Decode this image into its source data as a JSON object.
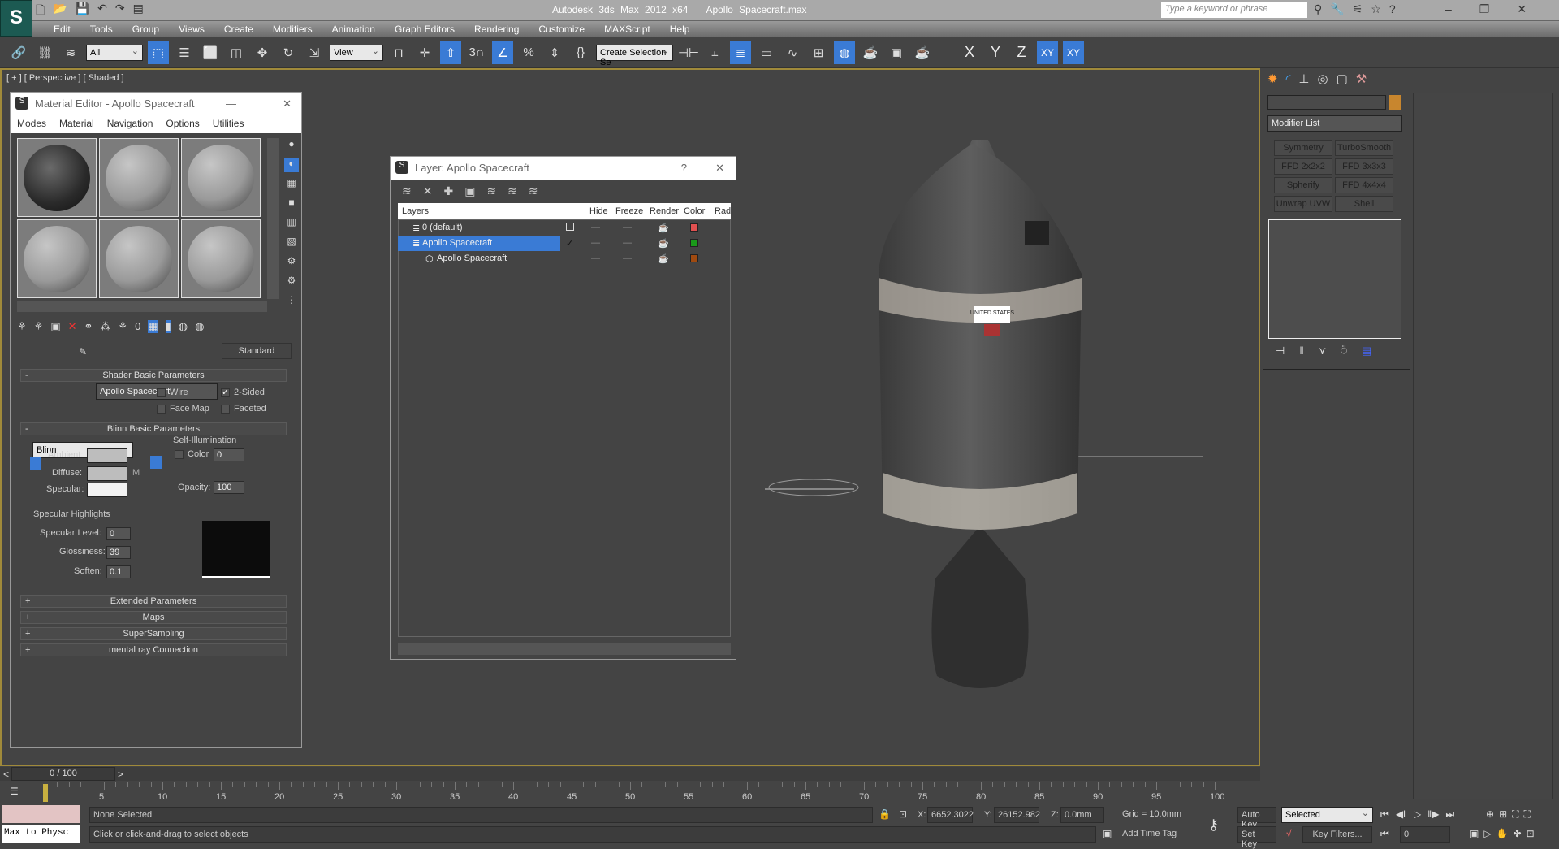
{
  "app": {
    "title": "Autodesk 3ds Max  2012 x64",
    "file": "Apollo Spacecraft.max",
    "search_placeholder": "Type a keyword or phrase"
  },
  "menu": [
    "Edit",
    "Tools",
    "Group",
    "Views",
    "Create",
    "Modifiers",
    "Animation",
    "Graph Editors",
    "Rendering",
    "Customize",
    "MAXScript",
    "Help"
  ],
  "toolbar": {
    "filter": "All",
    "ref_coord": "View",
    "selection_set": "Create Selection Se",
    "axes": [
      "X",
      "Y",
      "Z",
      "XY",
      "XY"
    ]
  },
  "viewport": {
    "label": "[ + ] [ Perspective ] [ Shaded ]",
    "decal": "UNITED STATES"
  },
  "material_editor": {
    "title": "Material Editor - Apollo Spacecraft",
    "menu": [
      "Modes",
      "Material",
      "Navigation",
      "Options",
      "Utilities"
    ],
    "material_name": "Apollo Spacecraft",
    "material_type": "Standard",
    "shader": {
      "header": "Shader Basic Parameters",
      "type": "Blinn",
      "wire": "Wire",
      "two_sided": "2-Sided",
      "face_map": "Face Map",
      "faceted": "Faceted",
      "two_sided_checked": true
    },
    "blinn": {
      "header": "Blinn Basic Parameters",
      "self_illum": "Self-Illumination",
      "color_label": "Color",
      "color_value": "0",
      "ambient": "Ambient:",
      "diffuse": "Diffuse:",
      "specular": "Specular:",
      "m": "M",
      "opacity_label": "Opacity:",
      "opacity": "100",
      "highlights": "Specular Highlights",
      "spec_level_label": "Specular Level:",
      "spec_level": "0",
      "gloss_label": "Glossiness:",
      "gloss": "39",
      "soften_label": "Soften:",
      "soften": "0.1"
    },
    "rollouts": [
      "Extended Parameters",
      "Maps",
      "SuperSampling",
      "mental ray Connection"
    ]
  },
  "layer_dialog": {
    "title": "Layer: Apollo Spacecraft",
    "help": "?",
    "columns": [
      "Layers",
      "Hide",
      "Freeze",
      "Render",
      "Color",
      "Rad"
    ],
    "rows": [
      {
        "name": "0 (default)",
        "color": "#e05050"
      },
      {
        "name": "Apollo Spacecraft",
        "color": "#1a9a1a"
      },
      {
        "name": "Apollo Spacecraft",
        "color": "#a04a10"
      }
    ]
  },
  "command_panel": {
    "modifier_list": "Modifier List",
    "buttons": [
      "Symmetry",
      "TurboSmooth",
      "FFD 2x2x2",
      "FFD 3x3x3",
      "Spherify",
      "FFD 4x4x4",
      "Unwrap UVW",
      "Shell"
    ],
    "object_color": "#c8862e"
  },
  "timeline": {
    "slider": "0 / 100",
    "ticks": [
      5,
      10,
      15,
      20,
      25,
      30,
      35,
      40,
      45,
      50,
      55,
      60,
      65,
      70,
      75,
      80,
      85,
      90,
      95,
      100
    ]
  },
  "status": {
    "script_label": "Max to Physc",
    "selection": "None Selected",
    "prompt": "Click or click-and-drag to select objects",
    "x": "6652.3022",
    "y": "26152.982",
    "z": "0.0mm",
    "grid": "Grid = 10.0mm",
    "add_time_tag": "Add Time Tag",
    "auto_key": "Auto Key",
    "set_key": "Set Key",
    "key_mode": "Selected",
    "key_filters": "Key Filters...",
    "frame": "0"
  }
}
